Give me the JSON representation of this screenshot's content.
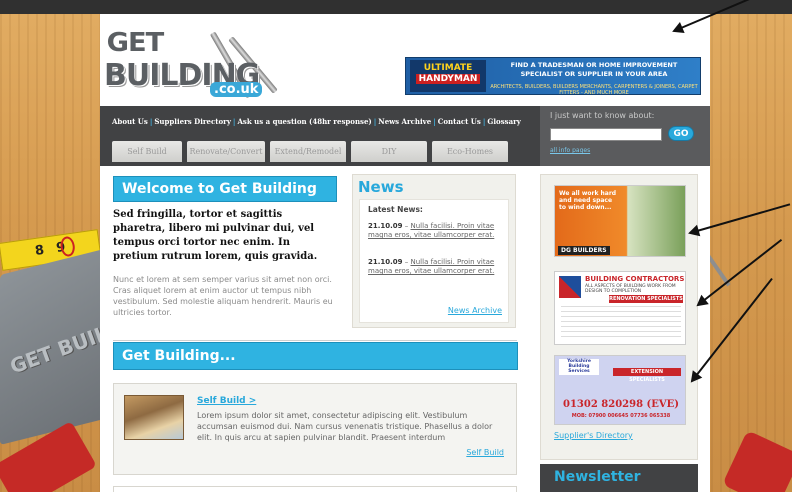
{
  "site": {
    "logo": {
      "line1": "GET",
      "line2": "BUILDING",
      "line3": ".co.uk"
    },
    "decor_saw_text": "GET BUILDING"
  },
  "banner_ad": {
    "brand": "ULTIMATE",
    "brand_sub": "HANDYMAN",
    "headline": "FIND A TRADESMAN OR HOME IMPROVEMENT SPECIALIST OR SUPPLIER IN YOUR AREA",
    "subline": "ARCHITECTS, BUILDERS, BUILDERS MERCHANTS, CARPENTERS & JOINERS, CARPET FITTERS - AND MUCH MORE"
  },
  "nav": {
    "links": [
      "About Us",
      "Suppliers Directory",
      "Ask us a question (48hr response)",
      "News Archive",
      "Contact Us",
      "Glossary"
    ],
    "tabs": [
      "Self Build",
      "Renovate/Convert",
      "Extend/Remodel",
      "DIY",
      "Eco-Homes"
    ]
  },
  "search": {
    "label": "I just want to know about:",
    "placeholder": "",
    "go_label": "GO",
    "all_pages": "all info pages"
  },
  "welcome": {
    "title": "Welcome to Get Building",
    "lead": "Sed fringilla, tortor et sagittis pharetra, libero mi pulvinar dui, vel tempus orci tortor nec enim. In pretium rutrum lorem, quis gravida.",
    "body": "Nunc et lorem at sem semper varius sit amet non orci. Cras aliquet lorem at enim auctor ut tempus nibh vestibulum. Sed molestie aliquam hendrerit. Mauris eu ultricies tortor."
  },
  "news": {
    "title": "News",
    "latest_label": "Latest News:",
    "items": [
      {
        "date": "21.10.09",
        "sep": " – ",
        "text": "Nulla facilisi. Proin vitae magna eros, vitae ullamcorper erat."
      },
      {
        "date": "21.10.09",
        "sep": " – ",
        "text": "Nulla facilisi. Proin vitae magna eros, vitae ullamcorper erat."
      }
    ],
    "archive_link": "News Archive"
  },
  "get_building": {
    "title": "Get Building...",
    "self_build": {
      "link": "Self Build >",
      "text": "Lorem ipsum dolor sit amet, consectetur adipiscing elit. Vestibulum accumsan euismod dui. Nam cursus venenatis tristique. Phasellus a dolor elit. In quis arcu at sapien pulvinar blandit. Praesent interdum",
      "more": "Self Build"
    }
  },
  "sidebar": {
    "ad1": {
      "text": "We all work hard and need space to wind down...",
      "footer": "DG BUILDERS"
    },
    "ad2": {
      "title": "BUILDING CONTRACTORS",
      "sub": "ALL ASPECTS OF BUILDING WORK FROM DESIGN TO COMPLETION",
      "ribbon": "RENOVATION SPECIALISTS"
    },
    "ad3": {
      "header": "Yorkshire Building Services",
      "ribbon": "EXTENSION SPECIALISTS",
      "phone": "01302 820298 (EVE)",
      "mobile": "MOB: 07900 006645   07736 065338"
    },
    "directory_link": "Supplier's Directory",
    "newsletter_title": "Newsletter"
  },
  "colors": {
    "accent": "#2fb3e1",
    "nav_bg": "#414244",
    "panel_bg": "#f1f1ec"
  },
  "icons": [
    "arrow-icon",
    "go-button-icon",
    "screw-icon"
  ]
}
